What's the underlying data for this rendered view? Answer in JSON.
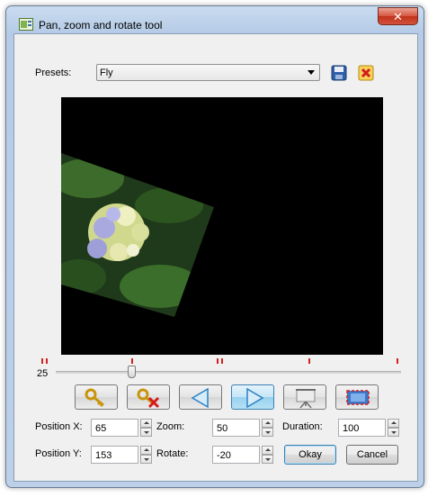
{
  "window": {
    "title": "Pan, zoom and rotate tool",
    "close_glyph": "✕"
  },
  "presets": {
    "label": "Presets:",
    "selected": "Fly",
    "save_icon": "floppy-disk-icon",
    "delete_icon": "red-x-delete-icon"
  },
  "timeline": {
    "start_value": "25",
    "marker_color": "#d32020"
  },
  "controls": [
    "add-keyframe-icon",
    "remove-keyframe-icon",
    "previous-icon",
    "next-icon",
    "preview-icon",
    "fullscreen-icon"
  ],
  "fields": {
    "position_x": {
      "label": "Position X:",
      "value": "65"
    },
    "position_y": {
      "label": "Position Y:",
      "value": "153"
    },
    "zoom": {
      "label": "Zoom:",
      "value": "50"
    },
    "rotate": {
      "label": "Rotate:",
      "value": "-20"
    },
    "duration": {
      "label": "Duration:",
      "value": "100"
    }
  },
  "buttons": {
    "okay": "Okay",
    "cancel": "Cancel"
  },
  "colors": {
    "accent": "#3c7fb1",
    "close": "#c2321b",
    "preview_bg": "#000000"
  }
}
